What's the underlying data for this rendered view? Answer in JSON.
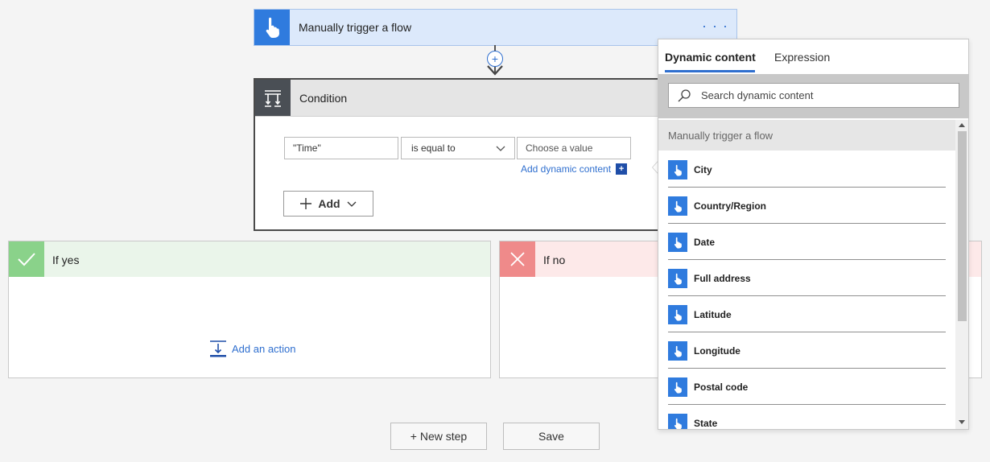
{
  "trigger": {
    "title": "Manually trigger a flow",
    "more": "· · ·",
    "icon": "hand-pointer-icon"
  },
  "condition": {
    "title": "Condition",
    "icon": "condition-icon",
    "left_value": "\"Time\"",
    "operator": "is equal to",
    "right_placeholder": "Choose a value",
    "add_dynamic_label": "Add dynamic content",
    "add_dynamic_badge": "+",
    "add_label": "Add"
  },
  "branches": {
    "yes": {
      "title": "If yes",
      "add_action": "Add an action"
    },
    "no": {
      "title": "If no"
    }
  },
  "buttons": {
    "new_step": "+ New step",
    "save": "Save"
  },
  "dynamic_panel": {
    "tabs": [
      "Dynamic content",
      "Expression"
    ],
    "active_tab": "Dynamic content",
    "search_placeholder": "Search dynamic content",
    "section_title": "Manually trigger a flow",
    "items": [
      "City",
      "Country/Region",
      "Date",
      "Full address",
      "Latitude",
      "Longitude",
      "Postal code",
      "State"
    ]
  },
  "colors": {
    "accent": "#2f6fcf",
    "trigger_icon_bg": "#2f7bde",
    "condition_icon_bg": "#4a4f55",
    "yes": "#8ad28a",
    "no": "#ef8a8a"
  }
}
